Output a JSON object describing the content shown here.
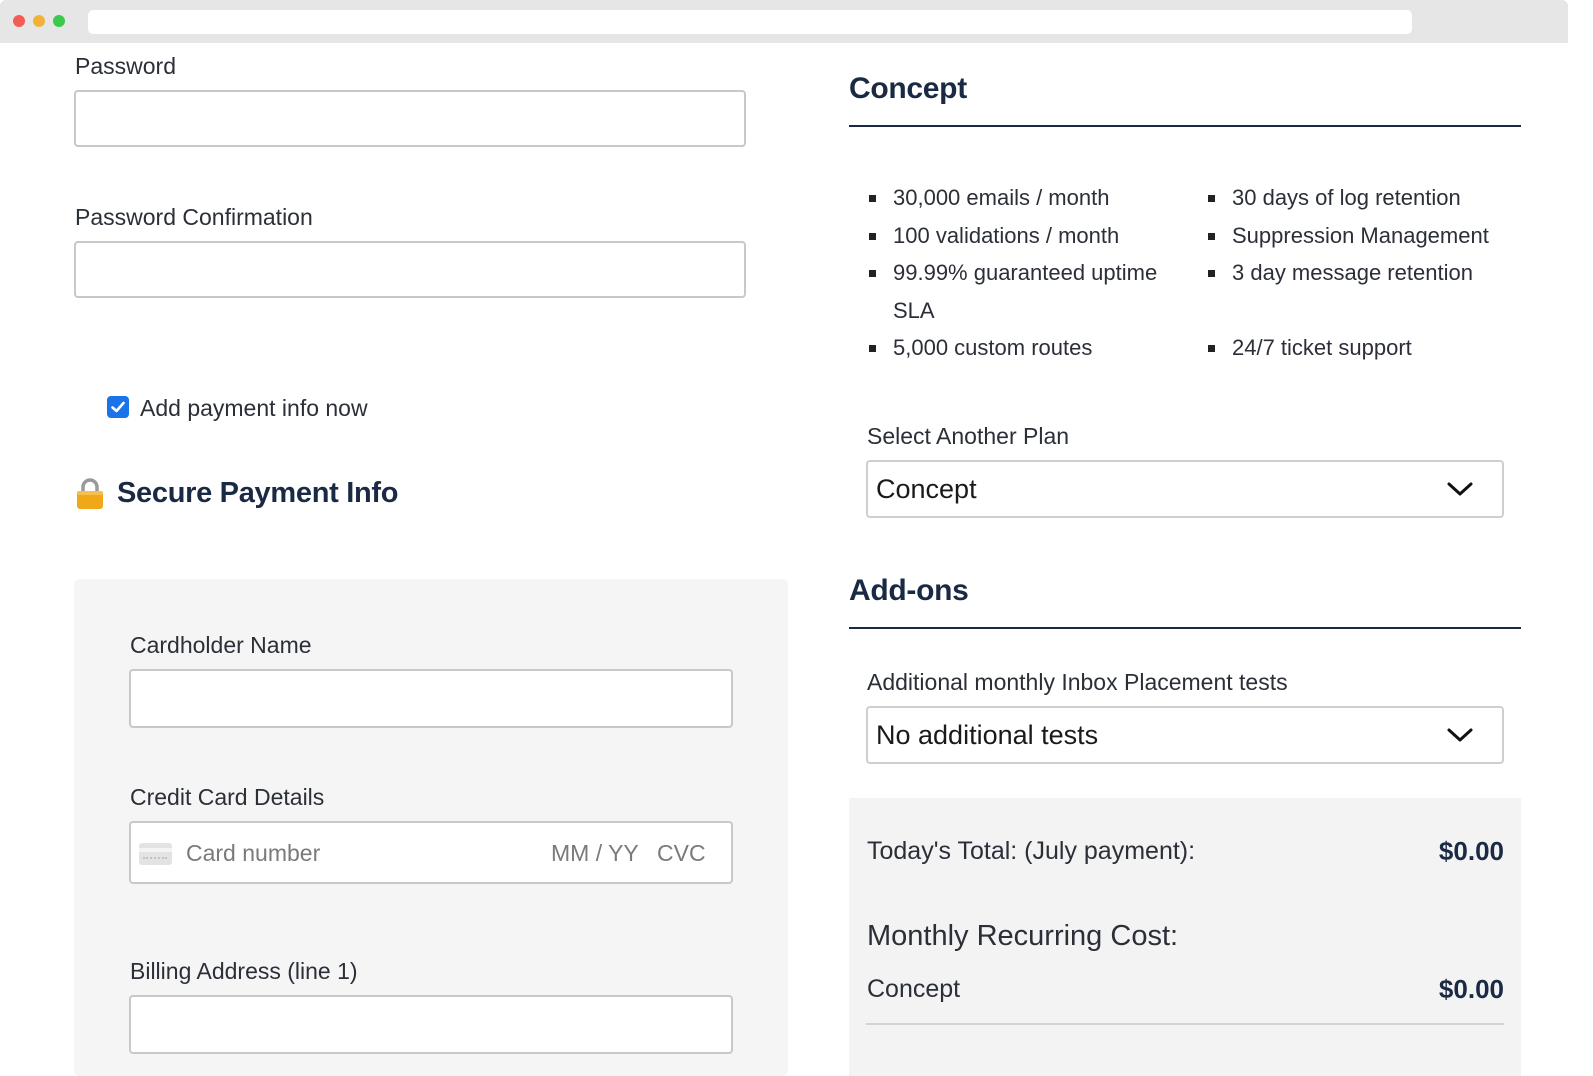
{
  "account": {
    "password_label": "Password",
    "password_confirmation_label": "Password Confirmation"
  },
  "payment_toggle": {
    "label": "Add payment info now",
    "checked": true
  },
  "payment": {
    "section_title": "Secure Payment Info",
    "cardholder_label": "Cardholder Name",
    "card_details_label": "Credit Card Details",
    "card_number_placeholder": "Card number",
    "expiry_placeholder": "MM / YY",
    "cvc_placeholder": "CVC",
    "billing_address_label": "Billing Address (line 1)"
  },
  "plan": {
    "title": "Concept",
    "features_left": [
      "30,000 emails / month",
      "100 validations / month",
      "99.99% guaranteed uptime SLA",
      "5,000 custom routes"
    ],
    "features_right": [
      "30 days of log retention",
      "Suppression Management",
      "3 day message retention",
      "24/7 ticket support"
    ],
    "select_label": "Select Another Plan",
    "select_value": "Concept"
  },
  "addons": {
    "title": "Add-ons",
    "tests_label": "Additional monthly Inbox Placement tests",
    "tests_value": "No additional tests"
  },
  "summary": {
    "today_label": "Today's Total: (July payment):",
    "today_amount": "$0.00",
    "recurring_label": "Monthly Recurring Cost:",
    "plan_name": "Concept",
    "plan_amount": "$0.00"
  },
  "colors": {
    "accent": "#1a73e8",
    "heading": "#1b2a44",
    "lock": "#f0a81a"
  }
}
